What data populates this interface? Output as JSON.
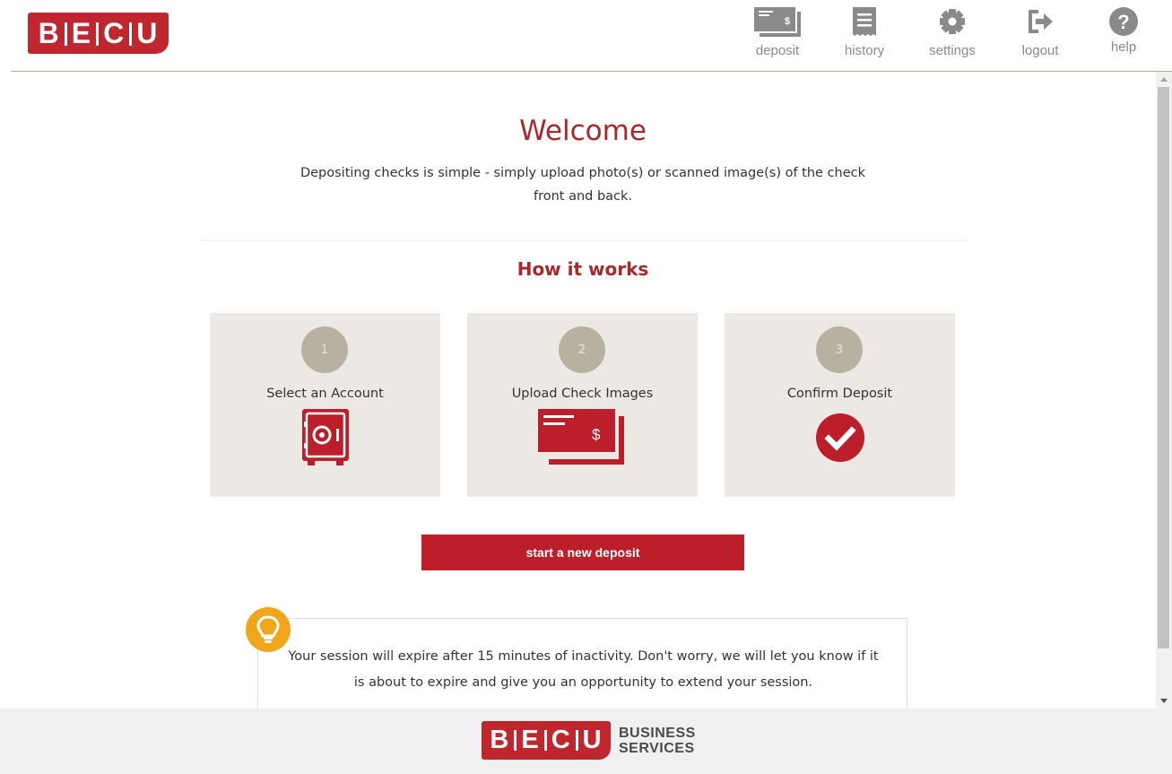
{
  "header": {
    "logo_letters": [
      "B",
      "E",
      "C",
      "U"
    ],
    "nav": [
      {
        "id": "deposit",
        "label": "deposit",
        "icon": "deposit-check-icon"
      },
      {
        "id": "history",
        "label": "history",
        "icon": "history-receipt-icon"
      },
      {
        "id": "settings",
        "label": "settings",
        "icon": "gear-icon"
      },
      {
        "id": "logout",
        "label": "logout",
        "icon": "logout-icon"
      },
      {
        "id": "help",
        "label": "help",
        "icon": "question-circle-icon"
      }
    ]
  },
  "main": {
    "title": "Welcome",
    "intro": "Depositing checks is simple - simply upload photo(s) or scanned image(s) of the check front and back.",
    "how_title": "How it works",
    "steps": [
      {
        "number": "1",
        "title": "Select an Account",
        "icon": "safe-icon"
      },
      {
        "number": "2",
        "title": "Upload Check Images",
        "icon": "check-images-icon"
      },
      {
        "number": "3",
        "title": "Confirm Deposit",
        "icon": "checkmark-circle-icon"
      }
    ],
    "cta_label": "start a new deposit",
    "tip": {
      "icon": "lightbulb-icon",
      "text": "Your session will expire after 15 minutes of inactivity. Don't worry, we will let you know if it is about to expire and give you an opportunity to extend your session."
    }
  },
  "footer": {
    "logo_letters": [
      "B",
      "E",
      "C",
      "U"
    ],
    "business_line1": "BUSINESS",
    "business_line2": "SERVICES"
  },
  "colors": {
    "brand_red": "#c0262d",
    "heading_red": "#a8282c",
    "card_bg": "#ece9e5",
    "step_circle": "#b8b1a1",
    "bulb": "#f1a51a",
    "nav_icon": "#8a8a8a"
  }
}
